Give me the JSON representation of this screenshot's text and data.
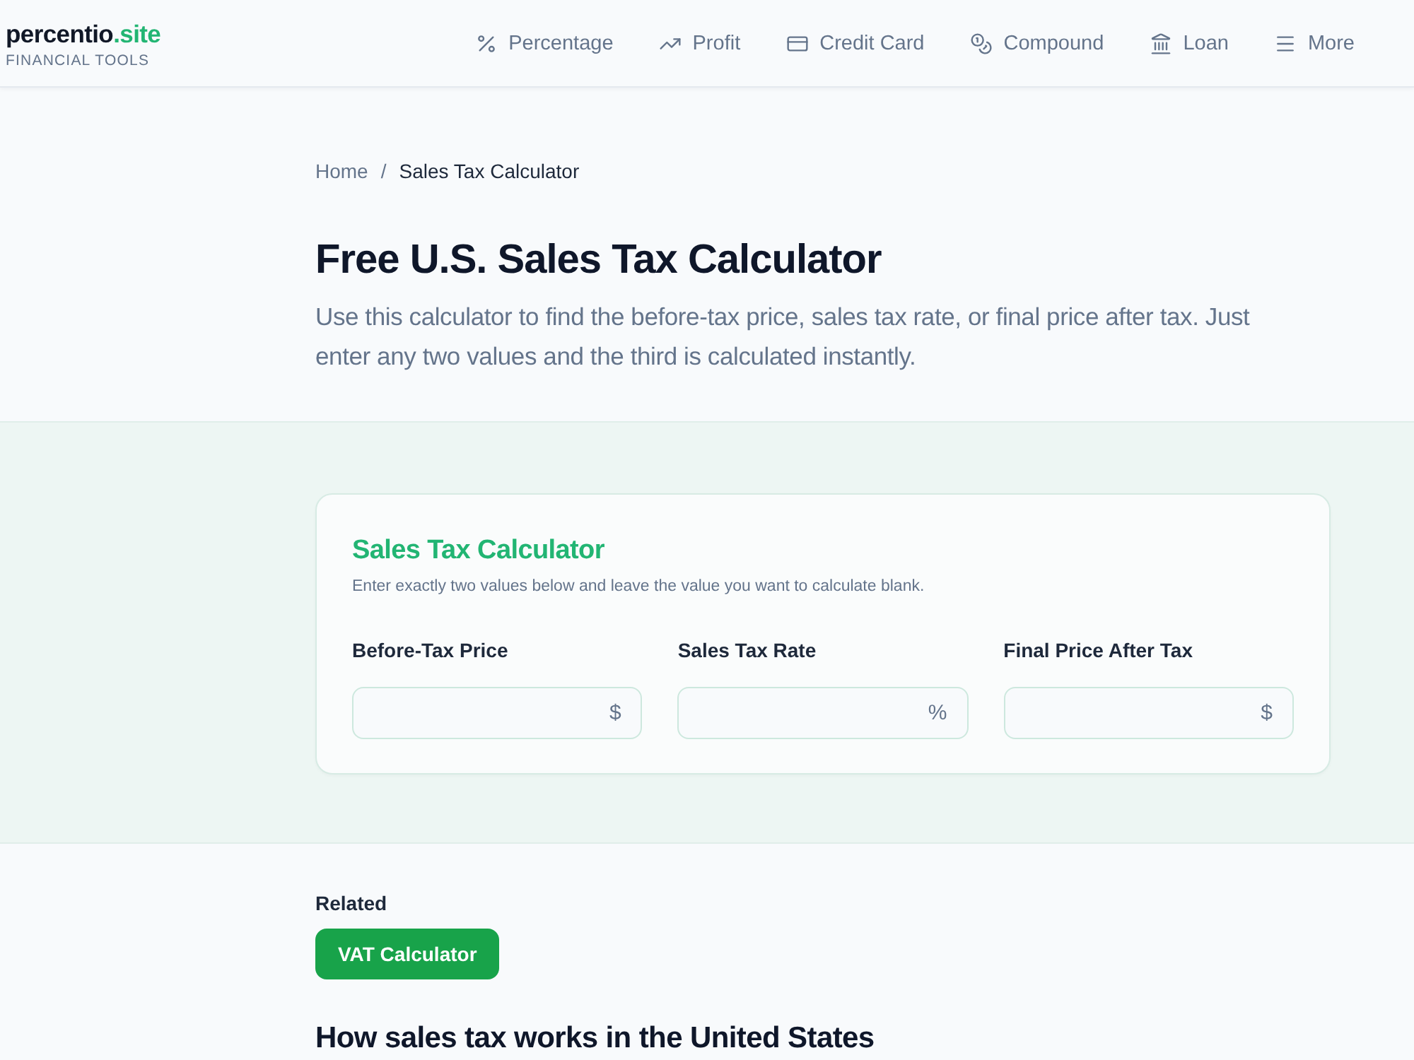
{
  "header": {
    "logo": {
      "name": "percentio",
      "accent": ".site"
    },
    "tagline": "FINANCIAL TOOLS",
    "nav": [
      {
        "label": "Percentage"
      },
      {
        "label": "Profit"
      },
      {
        "label": "Credit Card"
      },
      {
        "label": "Compound"
      },
      {
        "label": "Loan"
      },
      {
        "label": "More"
      }
    ]
  },
  "breadcrumb": {
    "separator": "/",
    "items": [
      {
        "label": "Home",
        "current": false
      },
      {
        "label": "Sales Tax Calculator",
        "current": true
      }
    ]
  },
  "hero": {
    "title": "Free U.S. Sales Tax Calculator",
    "intro": "Use this calculator to find the before-tax price, sales tax rate, or final price after tax. Just enter any two values and the third is calculated instantly."
  },
  "calculator": {
    "title": "Sales Tax Calculator",
    "hint": "Enter exactly two values below and leave the value you want to calculate blank.",
    "fields": [
      {
        "label": "Before-Tax Price",
        "unit": "$"
      },
      {
        "label": "Sales Tax Rate",
        "unit": "%"
      },
      {
        "label": "Final Price After Tax",
        "unit": "$"
      }
    ]
  },
  "related": {
    "heading": "Related",
    "links": [
      "VAT Calculator"
    ]
  },
  "article": {
    "heading": "How sales tax works in the United States"
  }
}
